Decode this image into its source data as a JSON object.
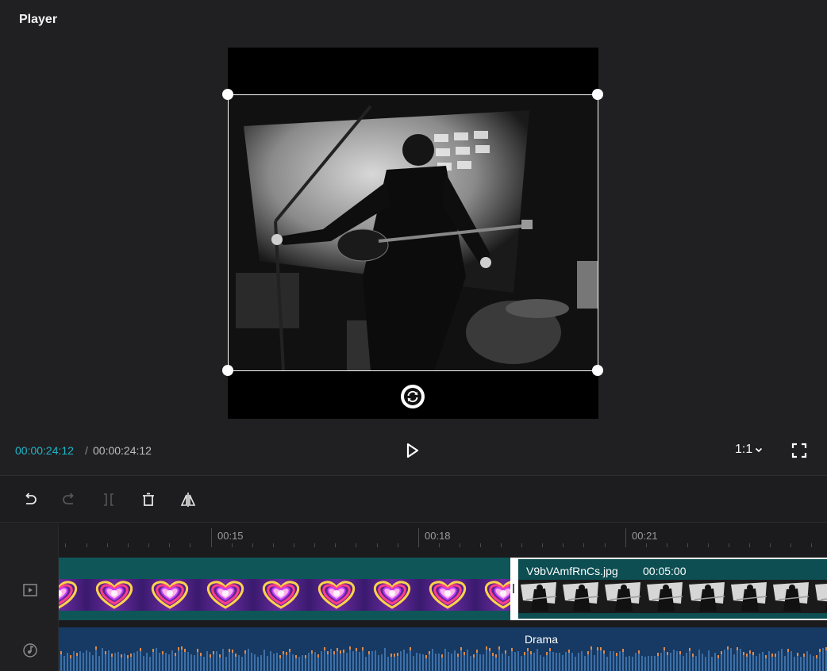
{
  "player": {
    "title": "Player",
    "current_time": "00:00:24:12",
    "separator": "/",
    "total_time": "00:00:24:12",
    "ratio": "1:1"
  },
  "toolbar": {
    "tools": [
      "undo-icon",
      "redo-icon",
      "split-icon",
      "delete-icon",
      "mirror-icon"
    ]
  },
  "timeline": {
    "ruler_labels": [
      "00:15",
      "00:18",
      "00:21"
    ],
    "video_clip_2": {
      "name": "V9bVAmfRnCs.jpg",
      "duration": "00:05:00"
    },
    "audio_clip": {
      "name": "Drama"
    }
  },
  "colors": {
    "accent": "#1fb6c9",
    "video_track": "#0f5659",
    "audio_track": "#163a63"
  }
}
